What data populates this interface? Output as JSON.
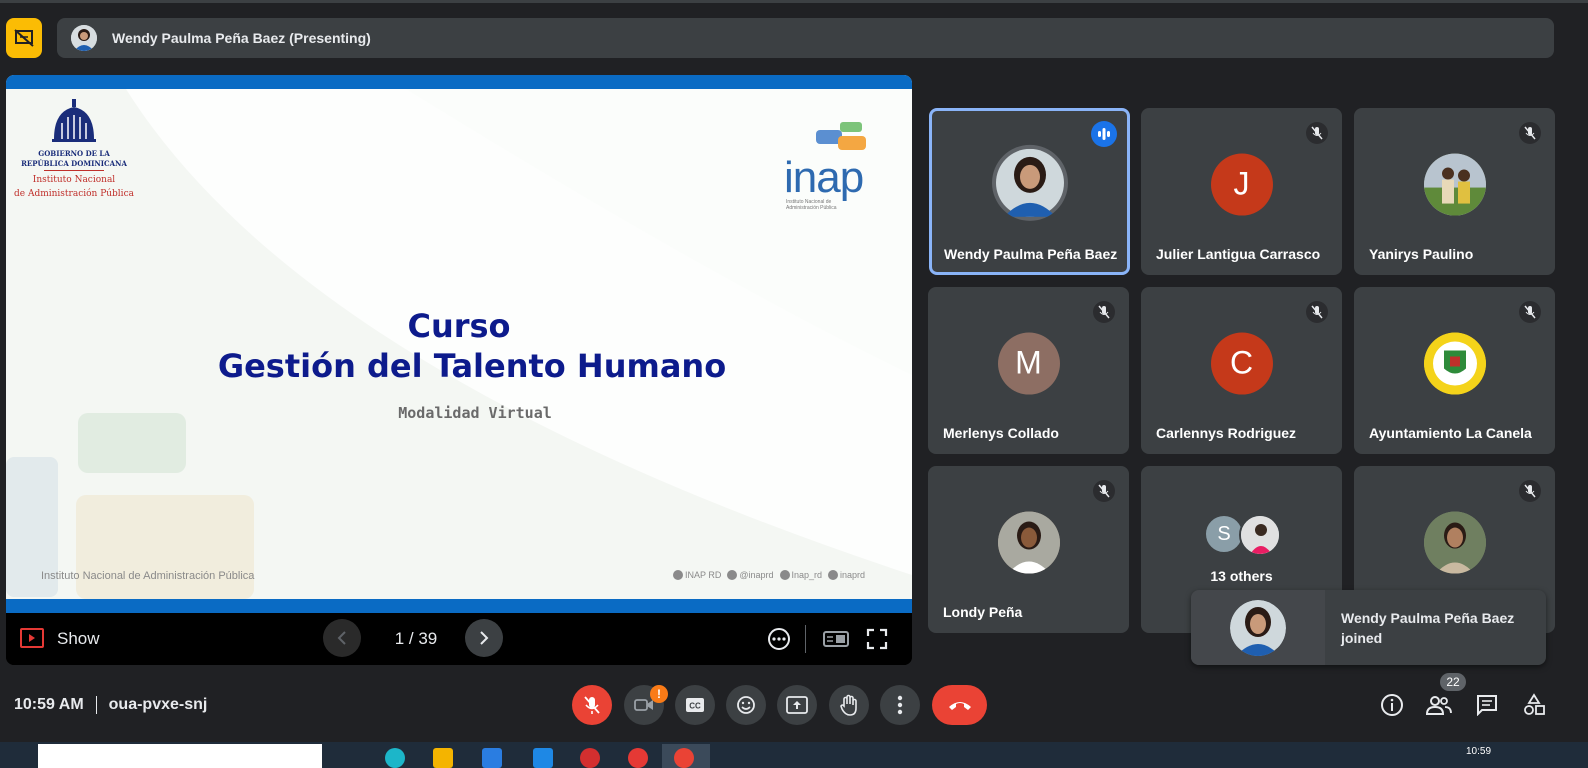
{
  "header": {
    "presenting_text": "Wendy Paulma Peña Baez (Presenting)"
  },
  "slide": {
    "title_line1": "Curso",
    "title_line2": "Gestión del Talento Humano",
    "subtitle": "Modalidad Virtual",
    "footer_left": "Instituto Nacional de Administración Pública",
    "gov_line1": "GOBIERNO DE LA",
    "gov_line2": "REPÚBLICA DOMINICANA",
    "gov_line3": "Instituto Nacional",
    "gov_line4": "de Administración Pública",
    "logo_word": "inap",
    "logo_small1": "Instituto Nacional de",
    "logo_small2": "Administración Pública",
    "socials": [
      "INAP RD",
      "@inaprd",
      "Inap_rd",
      "inaprd"
    ]
  },
  "slide_controls": {
    "show_label": "Show",
    "page": "1 / 39"
  },
  "participants": [
    {
      "name": "Wendy Paulma Peña Baez",
      "initial": "",
      "avatar_color": "#5f6368",
      "speaking": true
    },
    {
      "name": "Julier Lantigua Carrasco",
      "initial": "J",
      "avatar_color": "#c5391a",
      "speaking": false
    },
    {
      "name": "Yanirys Paulino",
      "initial": "",
      "avatar_color": "#8d9a7a",
      "speaking": false
    },
    {
      "name": "Merlenys Collado",
      "initial": "M",
      "avatar_color": "#8d6e63",
      "speaking": false
    },
    {
      "name": "Carlennys Rodriguez",
      "initial": "C",
      "avatar_color": "#c5391a",
      "speaking": false
    },
    {
      "name": "Ayuntamiento La Canela",
      "initial": "",
      "avatar_color": "#f4d31a",
      "speaking": false
    },
    {
      "name": "Londy Peña",
      "initial": "",
      "avatar_color": "#9e8a7a",
      "speaking": false
    },
    {
      "name": "",
      "initial": "",
      "avatar_color": "#7a8a6a",
      "speaking": false
    }
  ],
  "others_tile": {
    "label": "13 others",
    "initial": "S"
  },
  "toast": {
    "line1": "Wendy Paulma Peña Baez",
    "line2": "joined"
  },
  "footer": {
    "time": "10:59 AM",
    "meeting_code": "oua-pvxe-snj",
    "participant_count": "22",
    "camera_warning": "!"
  },
  "taskbar": {
    "time": "10:59"
  },
  "colors": {
    "accent_blue": "#8ab4f8",
    "danger_red": "#ea4335",
    "present_yellow": "#fbbc04",
    "slide_title": "#0d1b8c"
  }
}
